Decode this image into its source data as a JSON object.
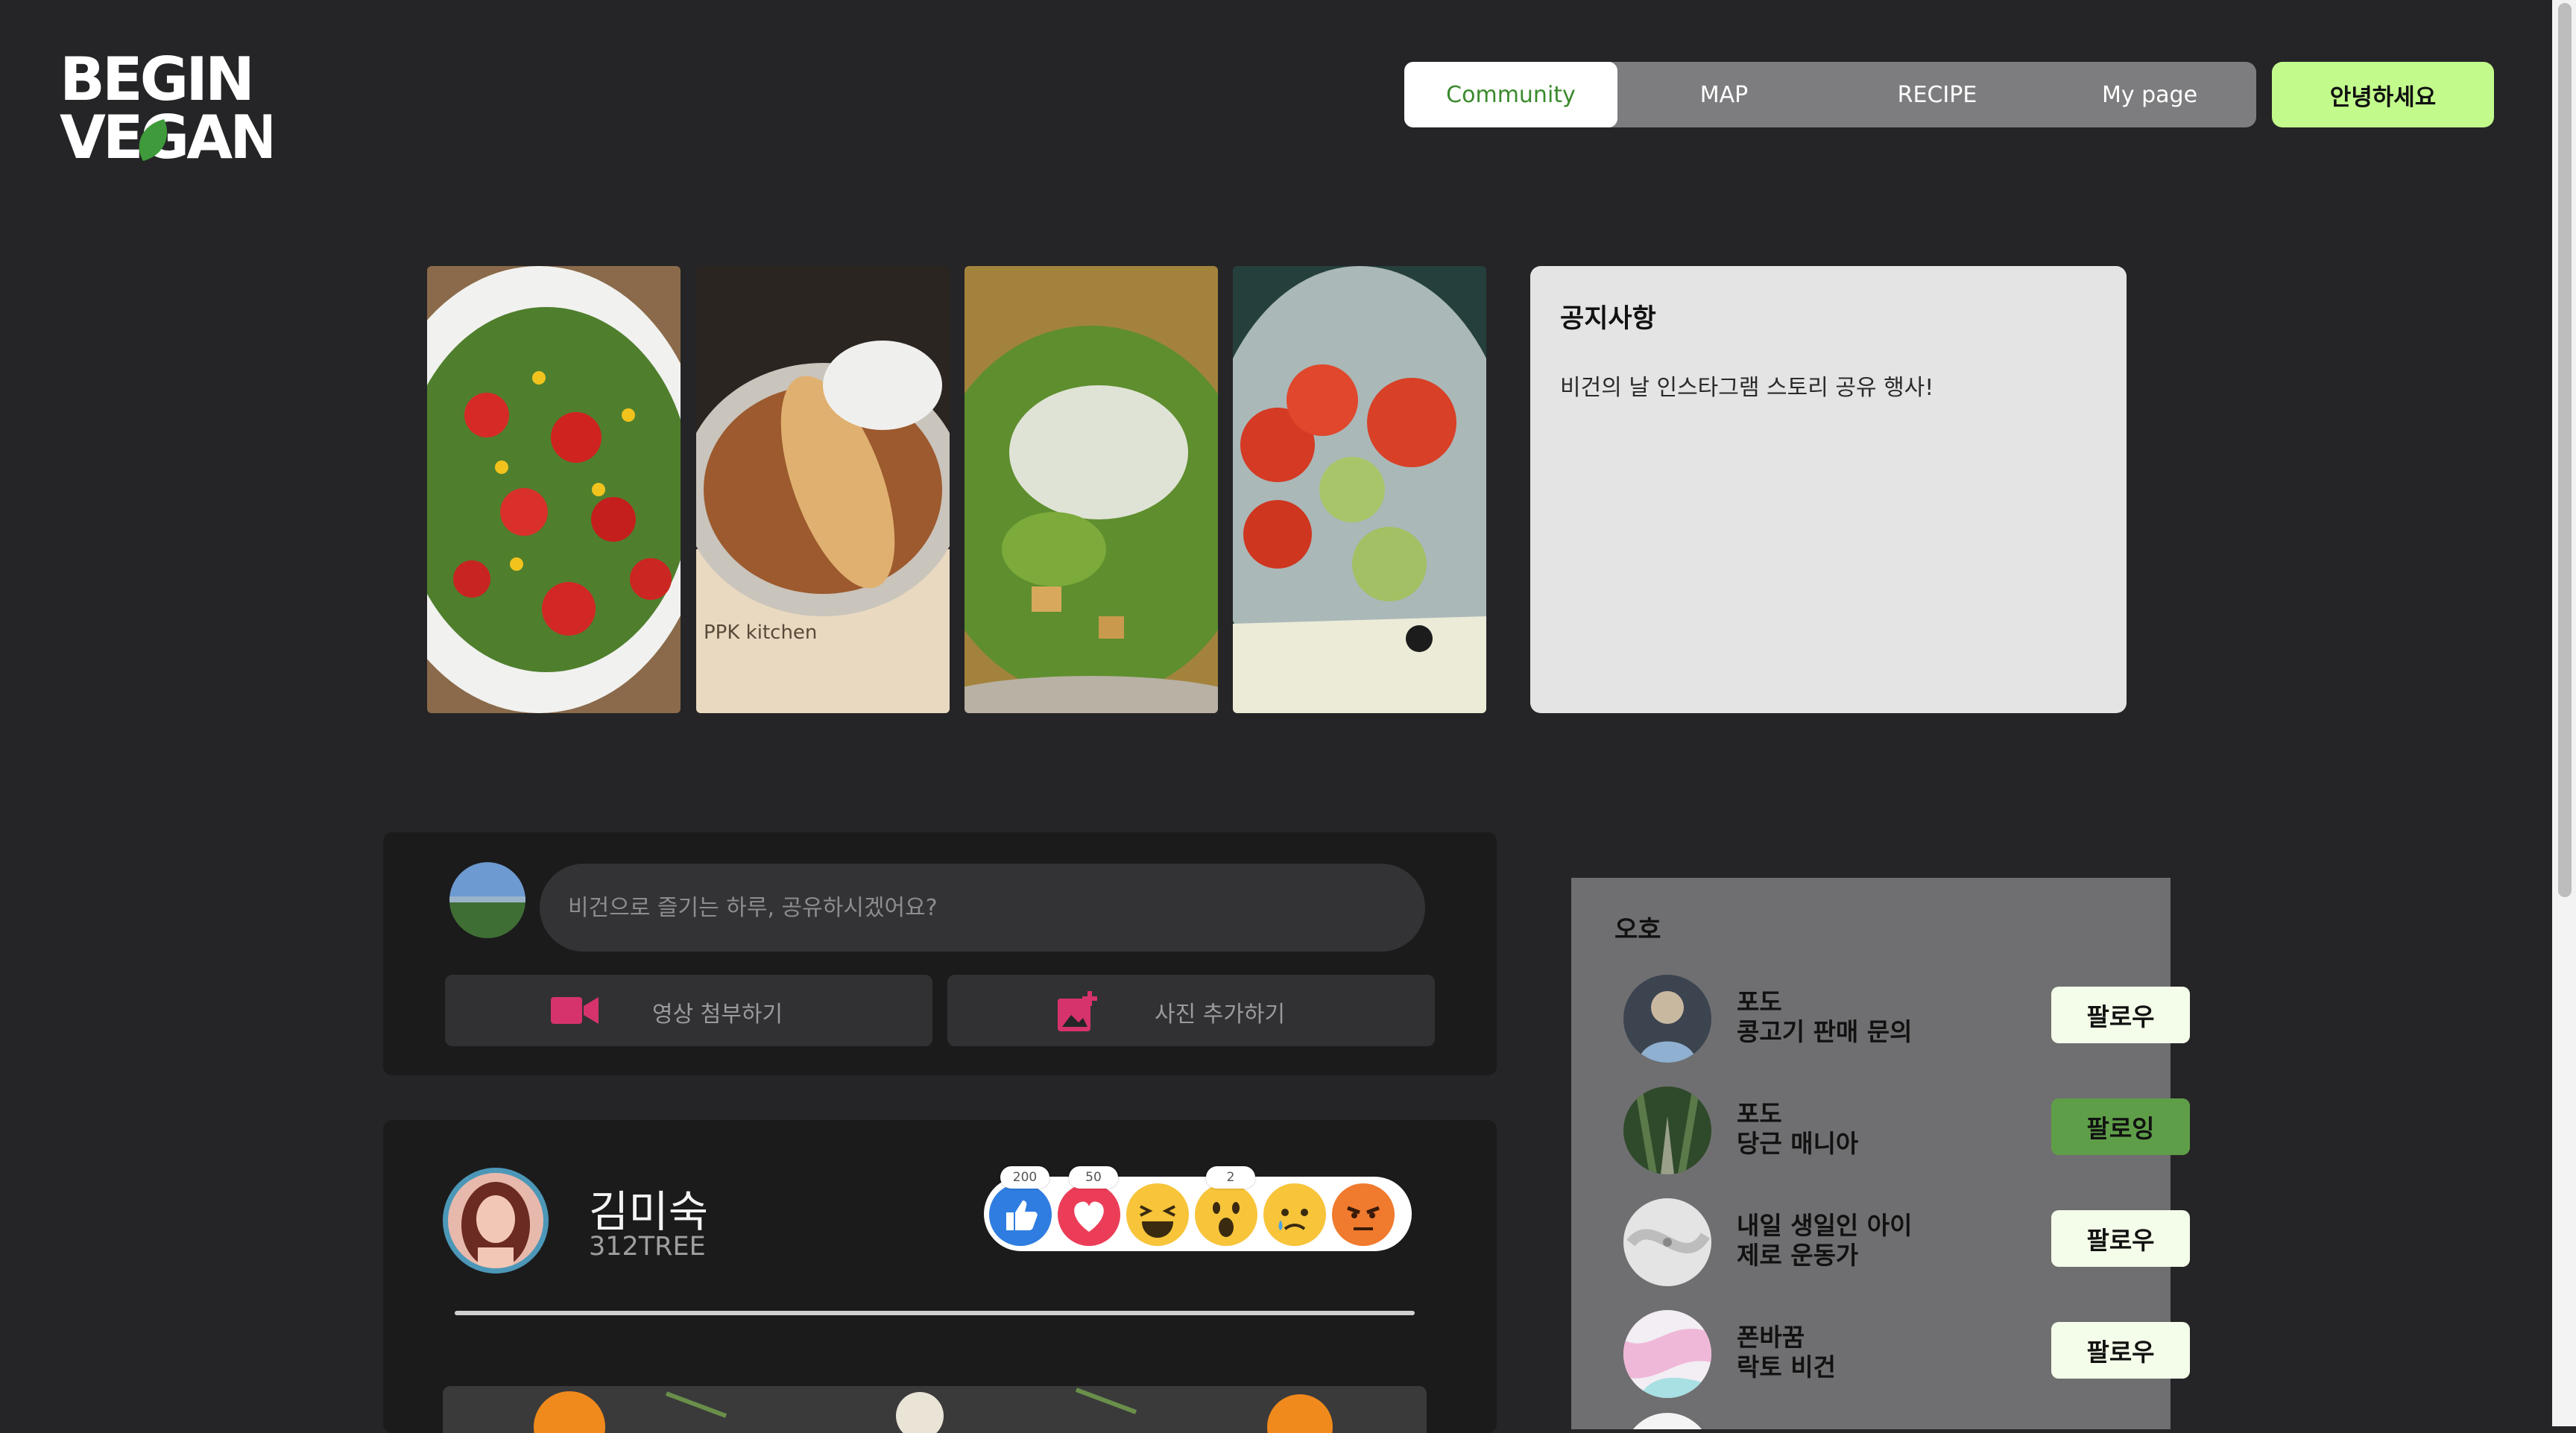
{
  "brand": {
    "logo_line1": "BEGIN",
    "logo_line2": "VEGAN"
  },
  "nav": {
    "items": [
      {
        "label": "Community",
        "active": true
      },
      {
        "label": "MAP",
        "active": false
      },
      {
        "label": "RECIPE",
        "active": false
      },
      {
        "label": "My page",
        "active": false
      }
    ],
    "greeting_button": "안녕하세요"
  },
  "notice": {
    "title": "공지사항",
    "items": [
      "비건의 날 인스타그램 스토리 공유 행사!"
    ]
  },
  "composer": {
    "placeholder": "비건으로 즐기는 하루, 공유하시겠어요?",
    "video_button": "영상 첨부하기",
    "photo_button": "사진 추가하기"
  },
  "post": {
    "author_name": "김미숙",
    "author_id": "312TREE",
    "reactions": [
      {
        "icon": "like-icon",
        "count": "200"
      },
      {
        "icon": "love-icon",
        "count": "50"
      },
      {
        "icon": "laugh-icon",
        "count": ""
      },
      {
        "icon": "wow-icon",
        "count": "2"
      },
      {
        "icon": "sad-icon",
        "count": ""
      },
      {
        "icon": "angry-icon",
        "count": ""
      }
    ]
  },
  "follow_panel": {
    "title": "오호",
    "users": [
      {
        "name": "포도",
        "desc": "콩고기 판매 문의",
        "button": "팔로우",
        "following": false
      },
      {
        "name": "포도",
        "desc": "당근 매니아",
        "button": "팔로잉",
        "following": true
      },
      {
        "name": "내일 생일인 아이",
        "desc": "제로 운동가",
        "button": "팔로우",
        "following": false
      },
      {
        "name": "폰바꿈",
        "desc": "락토 비건",
        "button": "팔로우",
        "following": false
      }
    ]
  },
  "colors": {
    "background": "#252527",
    "accent_green": "#c2fb8c",
    "active_nav_text": "#3a8a2c",
    "following_button": "#5f9e49",
    "follow_button": "#f4fde9",
    "reaction_pink": "#d6336c"
  }
}
